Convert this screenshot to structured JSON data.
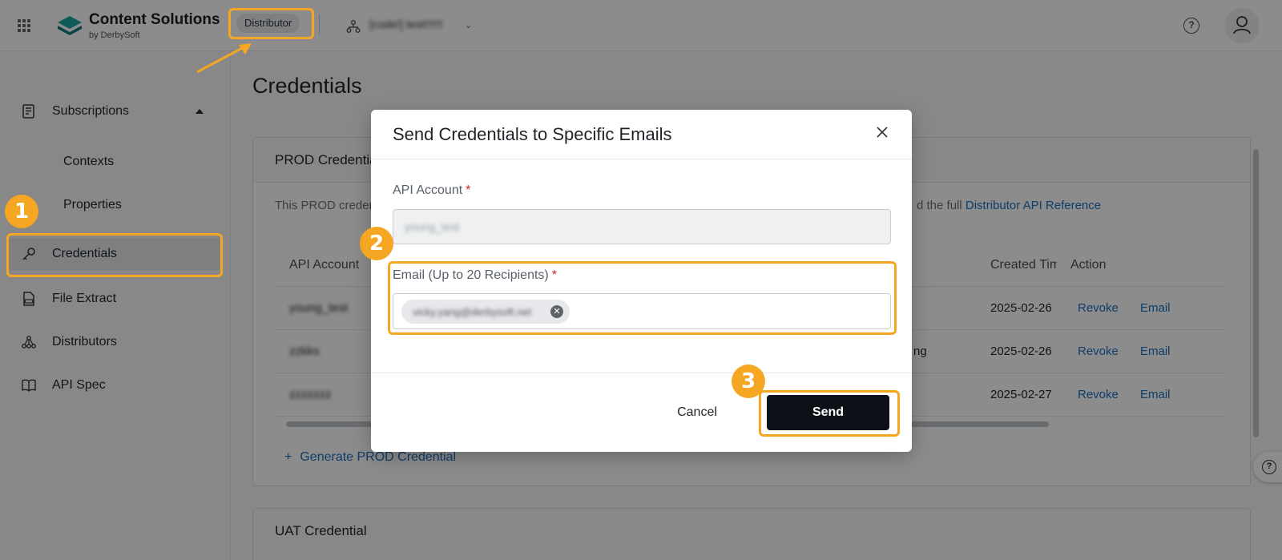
{
  "header": {
    "brand_name": "Content Solutions",
    "brand_sub": "by DerbySoft",
    "role": "Distributor",
    "org_name": "[code!] test!!!!!!",
    "icons": [
      "apps-grid-icon",
      "logo-icon",
      "org-tree-icon",
      "chevron-down-icon",
      "help-icon",
      "user-icon"
    ]
  },
  "sidebar": {
    "items": [
      {
        "label": "Subscriptions",
        "icon": "document-icon",
        "expanded": true
      },
      {
        "label": "Contexts"
      },
      {
        "label": "Properties"
      },
      {
        "label": "Credentials",
        "icon": "key-icon",
        "active": true
      },
      {
        "label": "File Extract",
        "icon": "file-icon"
      },
      {
        "label": "Distributors",
        "icon": "network-icon"
      },
      {
        "label": "API Spec",
        "icon": "book-icon"
      }
    ]
  },
  "main": {
    "title": "Credentials",
    "prod_card": {
      "title": "PROD Credential",
      "desc_start": "This PROD credential",
      "desc_tail": "d the full ",
      "desc_link": "Distributor API Reference",
      "columns": [
        "API Account",
        "Created Time",
        "Action"
      ],
      "rows": [
        {
          "account": "young_test",
          "extra": "",
          "created": "2025-02-26",
          "revoke": "Revoke",
          "email": "Email"
        },
        {
          "account": "zzkks",
          "extra": "ng",
          "created": "2025-02-26",
          "revoke": "Revoke",
          "email": "Email"
        },
        {
          "account": "zzzzzzz",
          "extra": "",
          "created": "2025-02-27",
          "revoke": "Revoke",
          "email": "Email"
        }
      ],
      "generate_label": "Generate PROD Credential"
    },
    "uat_card": {
      "title": "UAT Credential"
    }
  },
  "modal": {
    "title": "Send Credentials to Specific Emails",
    "api_account_label": "API Account",
    "api_account_value": "young_test",
    "email_label": "Email (Up to 20 Recipients)",
    "required_mark": "*",
    "email_tags": [
      "vicky.yang@derbysoft.net"
    ],
    "cancel_label": "Cancel",
    "send_label": "Send"
  },
  "annotations": {
    "badges": [
      "1",
      "2",
      "3"
    ],
    "accent_color": "#f5a623"
  },
  "colors": {
    "link": "#1c6fc2",
    "primary_button": "#0d1117",
    "required": "#cf222e"
  }
}
